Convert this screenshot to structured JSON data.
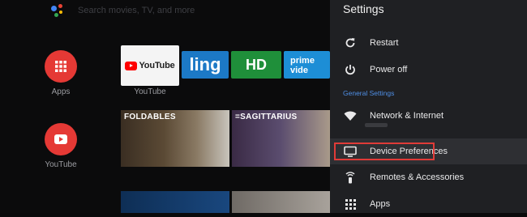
{
  "search": {
    "placeholder": "Search movies, TV, and more"
  },
  "left_apps": [
    {
      "label": "Apps",
      "icon": "apps-grid-icon",
      "color": "#e53935"
    },
    {
      "label": "YouTube",
      "icon": "youtube-play-icon",
      "color": "#e53935"
    }
  ],
  "tiles": {
    "youtube_logo": "YouTube",
    "youtube_caption": "YouTube",
    "sling": "ling",
    "hd": "HD",
    "prime": "prime vide"
  },
  "thumbs": {
    "t1_title": "FOLDABLES",
    "t2_title": "=SAGITTARIUS"
  },
  "settings": {
    "title": "Settings",
    "items_top": [
      {
        "label": "Restart",
        "icon": "restart-icon"
      },
      {
        "label": "Power off",
        "icon": "power-icon"
      }
    ],
    "section_label": "General Settings",
    "items_general": [
      {
        "label": "Network & Internet",
        "icon": "wifi-icon"
      },
      {
        "label": "Device Preferences",
        "icon": "tv-icon"
      },
      {
        "label": "Remotes & Accessories",
        "icon": "remote-icon"
      },
      {
        "label": "Apps",
        "icon": "apps-grid-icon"
      }
    ]
  },
  "colors": {
    "accent_section": "#4f8fe6",
    "highlight_border": "#e03b38"
  }
}
